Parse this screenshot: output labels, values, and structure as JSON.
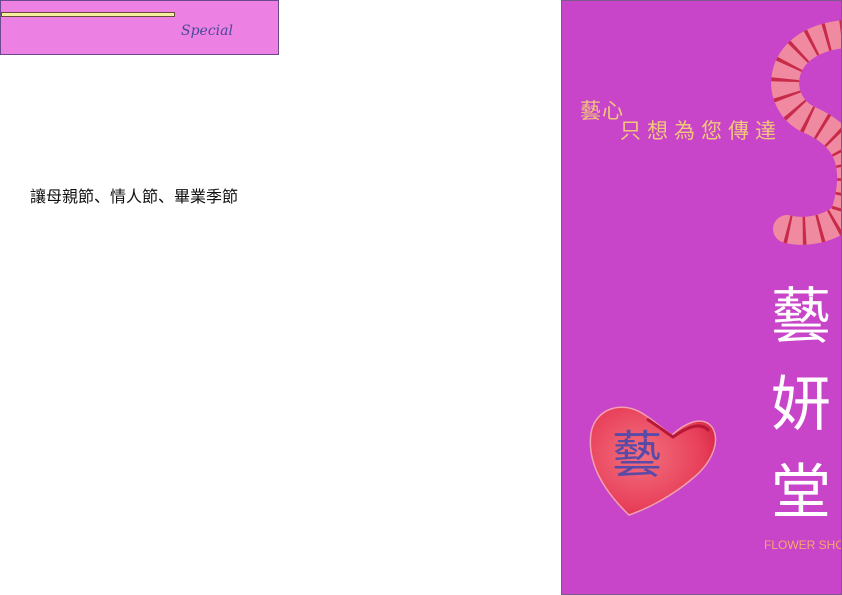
{
  "header": {
    "special_label": "Special"
  },
  "body": {
    "text": "讓母親節、情人節、畢業季節"
  },
  "cover": {
    "slogan_part1": "藝心",
    "slogan_part2": "只想為您傳達",
    "brand_name": [
      "藝",
      "妍",
      "堂"
    ],
    "shop_label": "FLOWER SHOP",
    "heart_char": "藝"
  },
  "colors": {
    "special_box": "#ec80e3",
    "cover_background": "#c844c8",
    "slogan": "#f2c77a",
    "heart": "#e8405a"
  }
}
